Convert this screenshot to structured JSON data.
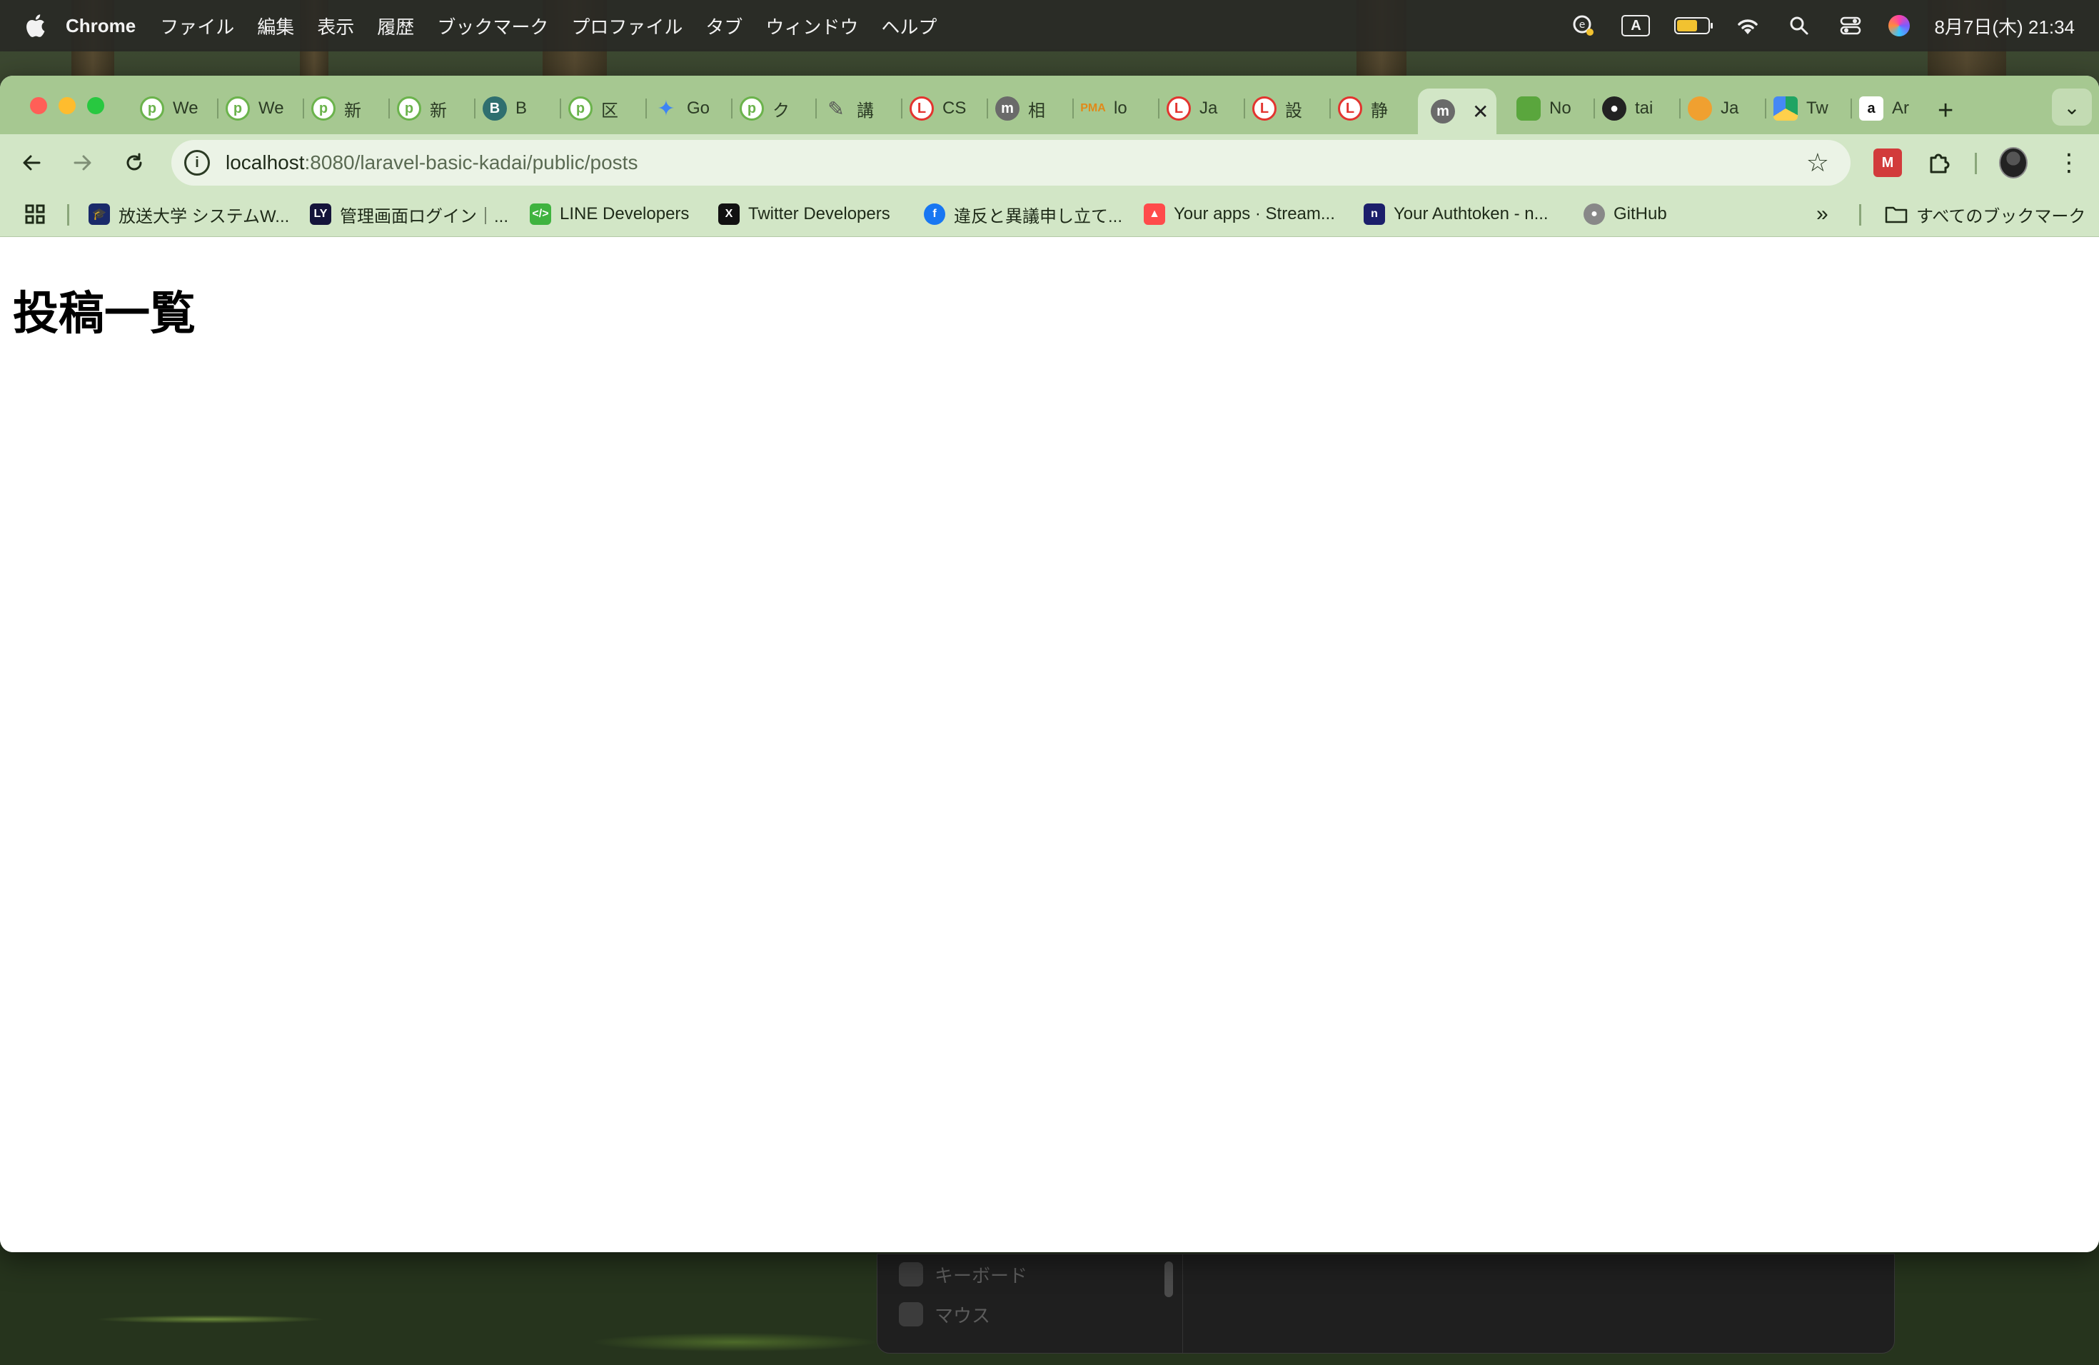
{
  "menubar": {
    "app": "Chrome",
    "items": [
      "ファイル",
      "編集",
      "表示",
      "履歴",
      "ブックマーク",
      "プロファイル",
      "タブ",
      "ウィンドウ",
      "ヘルプ"
    ],
    "input_mode": "A",
    "clock": "8月7日(木) 21:34"
  },
  "tabs": [
    {
      "title": "We",
      "icon": "p-icon"
    },
    {
      "title": "We",
      "icon": "p-icon"
    },
    {
      "title": "新",
      "icon": "p-icon"
    },
    {
      "title": "新",
      "icon": "p-icon"
    },
    {
      "title": "B",
      "icon": "b-icon"
    },
    {
      "title": "区",
      "icon": "p-icon"
    },
    {
      "title": "Go",
      "icon": "gemini-icon"
    },
    {
      "title": "ク",
      "icon": "p-icon"
    },
    {
      "title": "講",
      "icon": "pen-icon"
    },
    {
      "title": "CS",
      "icon": "laravel-icon"
    },
    {
      "title": "相",
      "icon": "mastodon-icon"
    },
    {
      "title": "lo",
      "icon": "phpmyadmin-icon"
    },
    {
      "title": "Ja",
      "icon": "laravel-icon"
    },
    {
      "title": "設",
      "icon": "laravel-icon"
    },
    {
      "title": "静",
      "icon": "laravel-icon"
    },
    {
      "title": "",
      "icon": "mastodon-icon",
      "active": true
    },
    {
      "title": "No",
      "icon": "node-icon"
    },
    {
      "title": "tai",
      "icon": "github-icon"
    },
    {
      "title": "Ja",
      "icon": "orange-icon"
    },
    {
      "title": "Tw",
      "icon": "drive-icon"
    },
    {
      "title": "Ar",
      "icon": "amazon-icon"
    }
  ],
  "address": {
    "host": "localhost",
    "path": ":8080/laravel-basic-kadai/public/posts"
  },
  "bookmarks": [
    {
      "label": "放送大学 システムW...",
      "icon": "graduation-icon"
    },
    {
      "label": "管理画面ログイン｜...",
      "icon": "ly-icon"
    },
    {
      "label": "LINE Developers",
      "icon": "line-dev-icon"
    },
    {
      "label": "Twitter Developers",
      "icon": "x-icon"
    },
    {
      "label": "違反と異議申し立て...",
      "icon": "facebook-icon"
    },
    {
      "label": "Your apps · Stream...",
      "icon": "streamlit-icon"
    },
    {
      "label": "Your Authtoken - n...",
      "icon": "ngrok-icon"
    },
    {
      "label": "GitHub",
      "icon": "github-icon"
    }
  ],
  "all_bookmarks": "すべてのブックマーク",
  "page": {
    "title": "投稿一覧"
  },
  "background_panel": {
    "items": [
      "キーボード",
      "マウス"
    ]
  }
}
